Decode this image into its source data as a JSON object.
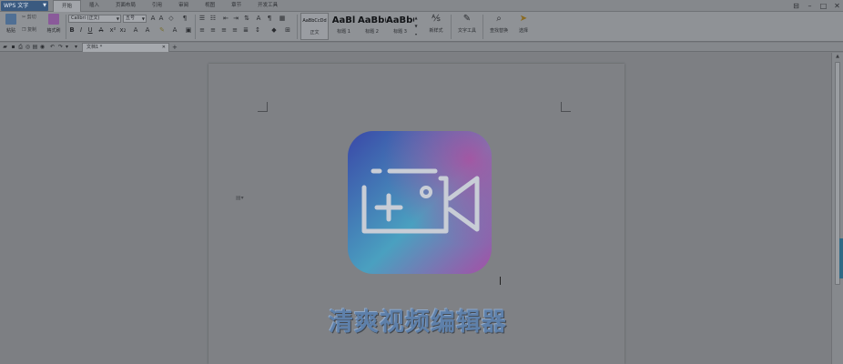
{
  "app": {
    "name": "WPS 文字"
  },
  "menu": {
    "tabs": [
      "开始",
      "插入",
      "页面布局",
      "引用",
      "审阅",
      "视图",
      "章节",
      "开发工具"
    ],
    "active": 0
  },
  "ribbon": {
    "paste": "粘贴",
    "cut": "剪切",
    "copy": "复制",
    "format_painter": "格式刷",
    "font_name": "Calibri (正文)",
    "font_size": "五号",
    "styles": [
      {
        "preview": "AaBbCcDd",
        "label": "正文"
      },
      {
        "preview": "AaBl",
        "label": "标题 1"
      },
      {
        "preview": "AaBb(",
        "label": "标题 2"
      },
      {
        "preview": "AaBbC",
        "label": "标题 3"
      }
    ],
    "new_style": "新样式",
    "text_tools": "文字工具",
    "find_replace": "查找替换",
    "select": "选择"
  },
  "document": {
    "tab_title": "文档1 *",
    "heading": "清爽视频编辑器"
  },
  "colors": {
    "logo_start": "#3a48a8",
    "logo_mid": "#4aa0c0",
    "logo_end": "#a54fa6",
    "heading": "#5e80aa"
  }
}
